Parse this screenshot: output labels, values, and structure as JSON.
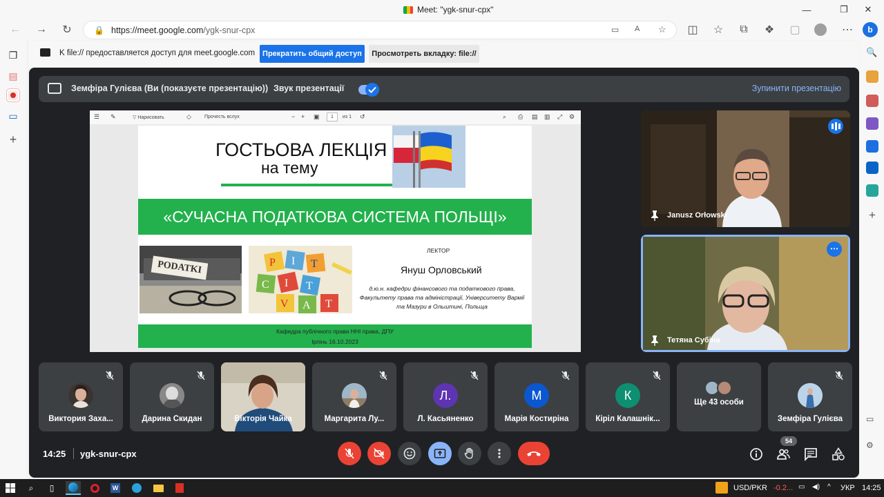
{
  "window": {
    "title": "Meet: \"ygk-snur-cpx\""
  },
  "browser": {
    "url_host": "https://meet.google.com",
    "url_path": "/ygk-snur-cpx"
  },
  "share_notice": {
    "message": "K file:// предоставляется доступ для meet.google.com",
    "stop_label": "Прекратить общий доступ",
    "view_tab_label": "Просмотреть вкладку: file://"
  },
  "presentation_bar": {
    "presenter": "Земфіра Гулієва (Ви (показуєте презентацію))",
    "sound_label": "Звук презентації",
    "stop_label": "Зупинити презентацію"
  },
  "pdf_toolbar": {
    "draw_label": "Нарисовать",
    "read_aloud_label": "Прочесть вслух",
    "page": "1",
    "of_pages": "из 1"
  },
  "slide": {
    "title_line1": "ГОСТЬОВА ЛЕКЦІЯ",
    "title_line2": "на тему",
    "topic": "«СУЧАСНА ПОДАТКОВА СИСТЕМА ПОЛЬЩІ»",
    "image_text_1": "PODATKI",
    "lecturer_heading": "ЛЕКТОР",
    "lecturer_name": "Януш Орловський",
    "lecturer_info": "д.ю.н. кафедри фінансового та податкового права, Факультету права та адміністрації, Університету Вармії та Мазури в Ольштині, Польща",
    "footer_line1": "Кафедра публічного права ННІ права, ДПУ",
    "footer_line2": "Ірпінь 16.10.2023"
  },
  "speakers": [
    {
      "name": "Janusz Orłowski"
    },
    {
      "name": "Тетяна Субіна"
    }
  ],
  "participants": [
    {
      "name": "Виктория Заха...",
      "avatar": "photo"
    },
    {
      "name": "Дарина Скидан",
      "avatar": "photo"
    },
    {
      "name": "Вікторія Чайка",
      "avatar": "video"
    },
    {
      "name": "Маргарита Лу...",
      "avatar": "photo"
    },
    {
      "name": "Л. Касьяненко",
      "initial": "Л.",
      "color": "#5e35b1"
    },
    {
      "name": "Марія Костиріна",
      "initial": "М",
      "color": "#0b57d0"
    },
    {
      "name": "Кіріл Калашнік...",
      "initial": "К",
      "color": "#0f8f72"
    },
    {
      "name": "Ще 43 особи",
      "avatar": "group"
    },
    {
      "name": "Земфіра Гулієва",
      "avatar": "photo"
    }
  ],
  "meeting": {
    "time": "14:25",
    "code": "ygk-snur-cpx",
    "people_count": "54"
  },
  "taskbar": {
    "ticker": "USD/PKR",
    "ticker_change": "-0.2...",
    "lang": "УКР",
    "clock": "14:25"
  },
  "colors": {
    "accent": "#1a73e8",
    "danger": "#ea4335",
    "meet_bg": "#202124",
    "slide_green": "#23b14d"
  }
}
